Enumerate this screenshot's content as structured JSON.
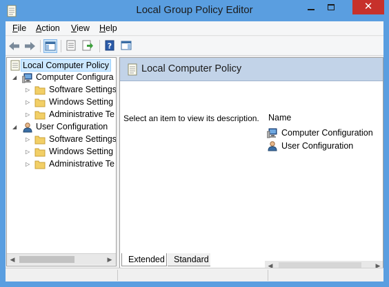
{
  "window": {
    "title": "Local Group Policy Editor",
    "minimize_glyph": "",
    "close_glyph": "✕"
  },
  "menu": {
    "file": {
      "mnemonic": "F",
      "rest": "ile"
    },
    "action": {
      "mnemonic": "A",
      "rest": "ction"
    },
    "view": {
      "mnemonic": "V",
      "rest": "iew"
    },
    "help": {
      "mnemonic": "H",
      "rest": "elp"
    }
  },
  "toolbar": {
    "icons": [
      "back-arrow-icon",
      "forward-arrow-icon",
      "show-hide-console-tree-icon",
      "properties-icon",
      "export-list-icon",
      "help-icon",
      "show-hide-action-pane-icon"
    ]
  },
  "tree": {
    "root": "Local Computer Policy",
    "computer_config": "Computer Configura",
    "computer_children": [
      "Software Settings",
      "Windows Setting",
      "Administrative Te"
    ],
    "user_config": "User Configuration",
    "user_children": [
      "Software Settings",
      "Windows Setting",
      "Administrative Te"
    ]
  },
  "details": {
    "header_title": "Local Computer Policy",
    "description": "Select an item to view its description.",
    "column_name": "Name",
    "items": [
      "Computer Configuration",
      "User Configuration"
    ]
  },
  "tabs": [
    "Extended",
    "Standard"
  ],
  "colors": {
    "titlebar": "#5a9ee0",
    "close_button": "#c7312b",
    "header_band": "#c2d3e8",
    "selection": "#cce8ff"
  }
}
